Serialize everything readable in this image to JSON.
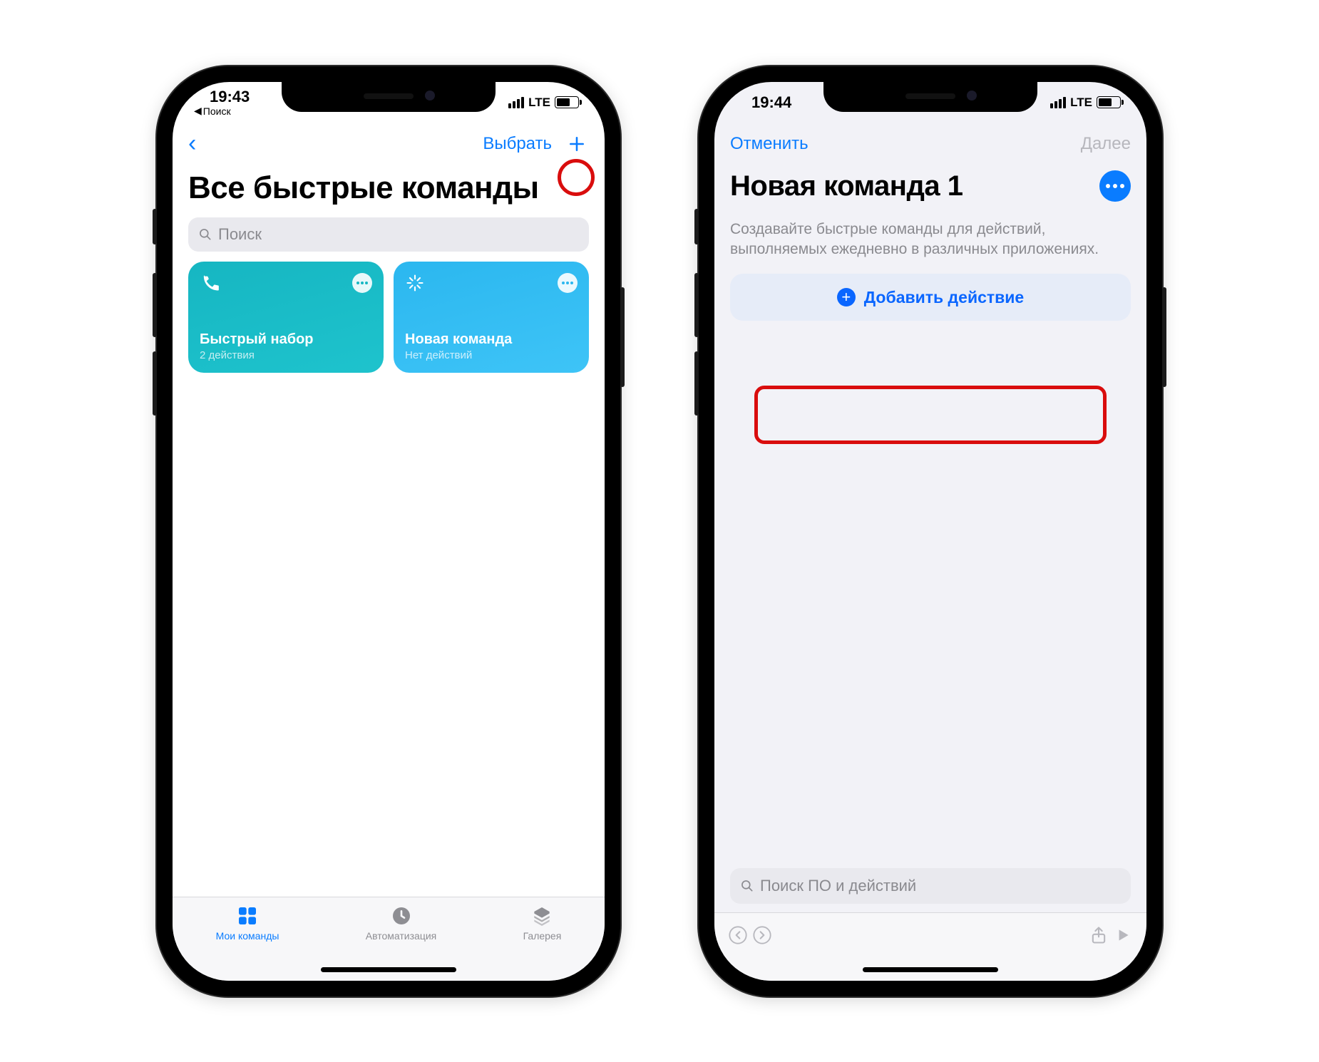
{
  "left": {
    "status": {
      "time": "19:43",
      "back_app": "Поиск",
      "net": "LTE"
    },
    "nav": {
      "select": "Выбрать"
    },
    "title": "Все быстрые команды",
    "search_placeholder": "Поиск",
    "cards": [
      {
        "title": "Быстрый набор",
        "subtitle": "2 действия"
      },
      {
        "title": "Новая команда",
        "subtitle": "Нет действий"
      }
    ],
    "tabs": {
      "shortcuts": "Мои команды",
      "automation": "Автоматизация",
      "gallery": "Галерея"
    }
  },
  "right": {
    "status": {
      "time": "19:44",
      "net": "LTE"
    },
    "nav": {
      "cancel": "Отменить",
      "next": "Далее"
    },
    "title": "Новая команда 1",
    "description": "Создавайте быстрые команды для действий, выполняемых ежедневно в различных приложениях.",
    "add_action": "Добавить действие",
    "search_placeholder": "Поиск ПО и действий"
  }
}
